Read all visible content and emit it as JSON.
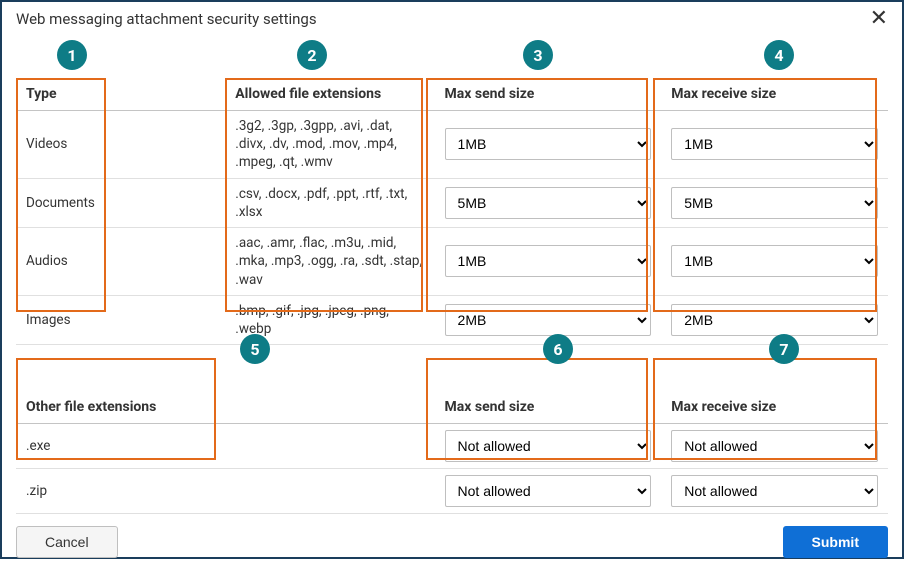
{
  "header": {
    "title": "Web messaging attachment security settings"
  },
  "badges": [
    "1",
    "2",
    "3",
    "4",
    "5",
    "6",
    "7"
  ],
  "table1": {
    "headers": {
      "type": "Type",
      "ext": "Allowed file extensions",
      "send": "Max send size",
      "recv": "Max receive size"
    },
    "rows": [
      {
        "type": "Videos",
        "ext": ".3g2, .3gp, .3gpp, .avi, .dat, .divx, .dv, .mod, .mov, .mp4, .mpeg, .qt, .wmv",
        "send": "1MB",
        "recv": "1MB"
      },
      {
        "type": "Documents",
        "ext": ".csv, .docx, .pdf, .ppt, .rtf, .txt, .xlsx",
        "send": "5MB",
        "recv": "5MB"
      },
      {
        "type": "Audios",
        "ext": ".aac, .amr, .flac, .m3u, .mid, .mka, .mp3, .ogg, .ra, .sdt, .stap, .wav",
        "send": "1MB",
        "recv": "1MB"
      },
      {
        "type": "Images",
        "ext": ".bmp, .gif, .jpg, .jpeg, .png, .webp",
        "send": "2MB",
        "recv": "2MB"
      }
    ]
  },
  "table2": {
    "headers": {
      "other": "Other file extensions",
      "send": "Max send size",
      "recv": "Max receive size"
    },
    "rows": [
      {
        "ext": ".exe",
        "send": "Not allowed",
        "recv": "Not allowed"
      },
      {
        "ext": ".zip",
        "send": "Not allowed",
        "recv": "Not allowed"
      }
    ]
  },
  "footer": {
    "cancel": "Cancel",
    "submit": "Submit"
  }
}
